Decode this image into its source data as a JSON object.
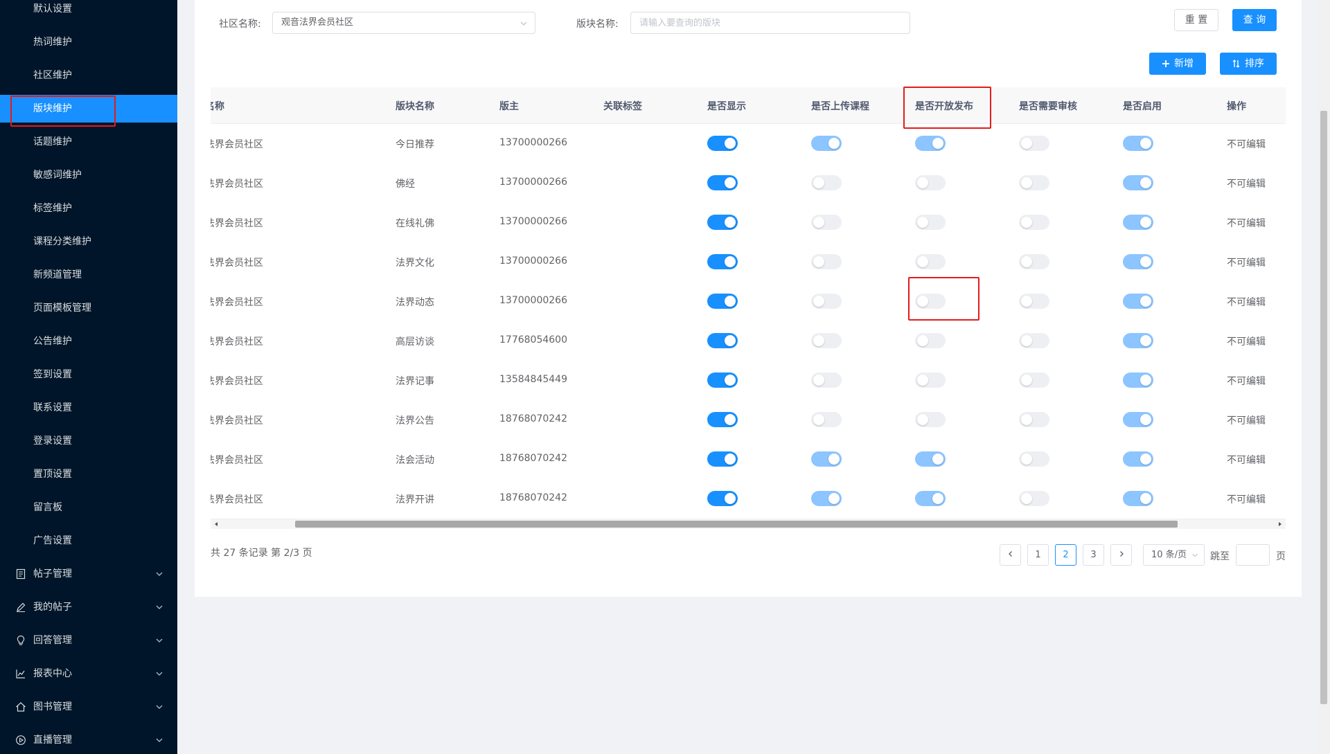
{
  "sidebar": {
    "items": [
      {
        "label": "默认设置"
      },
      {
        "label": "热词维护"
      },
      {
        "label": "社区维护"
      },
      {
        "label": "版块维护",
        "active": true
      },
      {
        "label": "话题维护"
      },
      {
        "label": "敏感词维护"
      },
      {
        "label": "标签维护"
      },
      {
        "label": "课程分类维护"
      },
      {
        "label": "新频道管理"
      },
      {
        "label": "页面模板管理"
      },
      {
        "label": "公告维护"
      },
      {
        "label": "签到设置"
      },
      {
        "label": "联系设置"
      },
      {
        "label": "登录设置"
      },
      {
        "label": "置顶设置"
      },
      {
        "label": "留言板"
      },
      {
        "label": "广告设置"
      }
    ],
    "groups": [
      {
        "label": "帖子管理",
        "icon": "document-icon"
      },
      {
        "label": "我的帖子",
        "icon": "edit-icon"
      },
      {
        "label": "回答管理",
        "icon": "bulb-icon"
      },
      {
        "label": "报表中心",
        "icon": "line-chart-icon"
      },
      {
        "label": "图书管理",
        "icon": "home-icon"
      },
      {
        "label": "直播管理",
        "icon": "play-circle-icon"
      }
    ]
  },
  "filters": {
    "community_label": "社区名称:",
    "community_value": "观音法界会员社区",
    "section_label": "版块名称:",
    "section_placeholder": "请输入要查询的版块",
    "reset_label": "重 置",
    "search_label": "查 询"
  },
  "actions": {
    "add_label": "新增",
    "sort_label": "排序"
  },
  "table": {
    "headers": [
      "名称",
      "版块名称",
      "版主",
      "关联标签",
      "是否显示",
      "是否上传课程",
      "是否开放发布",
      "是否需要审核",
      "是否启用",
      "操作"
    ],
    "rows": [
      {
        "community": "法界会员社区",
        "section": "今日推荐",
        "moderator": "13700000266",
        "tag": "",
        "show": true,
        "upload": true,
        "open": true,
        "review": false,
        "enabled": true,
        "op": "不可编辑"
      },
      {
        "community": "法界会员社区",
        "section": "佛经",
        "moderator": "13700000266",
        "tag": "",
        "show": true,
        "upload": false,
        "open": false,
        "review": false,
        "enabled": true,
        "op": "不可编辑"
      },
      {
        "community": "法界会员社区",
        "section": "在线礼佛",
        "moderator": "13700000266",
        "tag": "",
        "show": true,
        "upload": false,
        "open": false,
        "review": false,
        "enabled": true,
        "op": "不可编辑"
      },
      {
        "community": "法界会员社区",
        "section": "法界文化",
        "moderator": "13700000266",
        "tag": "",
        "show": true,
        "upload": false,
        "open": false,
        "review": false,
        "enabled": true,
        "op": "不可编辑"
      },
      {
        "community": "法界会员社区",
        "section": "法界动态",
        "moderator": "13700000266",
        "tag": "",
        "show": true,
        "upload": false,
        "open": false,
        "review": false,
        "enabled": true,
        "op": "不可编辑"
      },
      {
        "community": "法界会员社区",
        "section": "高层访谈",
        "moderator": "17768054600",
        "tag": "",
        "show": true,
        "upload": false,
        "open": false,
        "review": false,
        "enabled": true,
        "op": "不可编辑"
      },
      {
        "community": "法界会员社区",
        "section": "法界记事",
        "moderator": "13584845449",
        "tag": "",
        "show": true,
        "upload": false,
        "open": false,
        "review": false,
        "enabled": true,
        "op": "不可编辑"
      },
      {
        "community": "法界会员社区",
        "section": "法界公告",
        "moderator": "18768070242",
        "tag": "",
        "show": true,
        "upload": false,
        "open": false,
        "review": false,
        "enabled": true,
        "op": "不可编辑"
      },
      {
        "community": "法界会员社区",
        "section": "法会活动",
        "moderator": "18768070242",
        "tag": "",
        "show": true,
        "upload": true,
        "open": true,
        "review": false,
        "enabled": true,
        "op": "不可编辑"
      },
      {
        "community": "法界会员社区",
        "section": "法界开讲",
        "moderator": "18768070242",
        "tag": "",
        "show": true,
        "upload": true,
        "open": true,
        "review": false,
        "enabled": true,
        "op": "不可编辑"
      }
    ]
  },
  "pagination": {
    "total_text": "共 27 条记录 第 2/3 页",
    "pages": [
      "1",
      "2",
      "3"
    ],
    "current": "2",
    "page_size": "10 条/页",
    "jump_label": "跳至",
    "page_suffix": "页"
  },
  "colors": {
    "accent": "#1890ff",
    "sidebar_bg": "#001529",
    "highlight": "#e31b1b"
  }
}
